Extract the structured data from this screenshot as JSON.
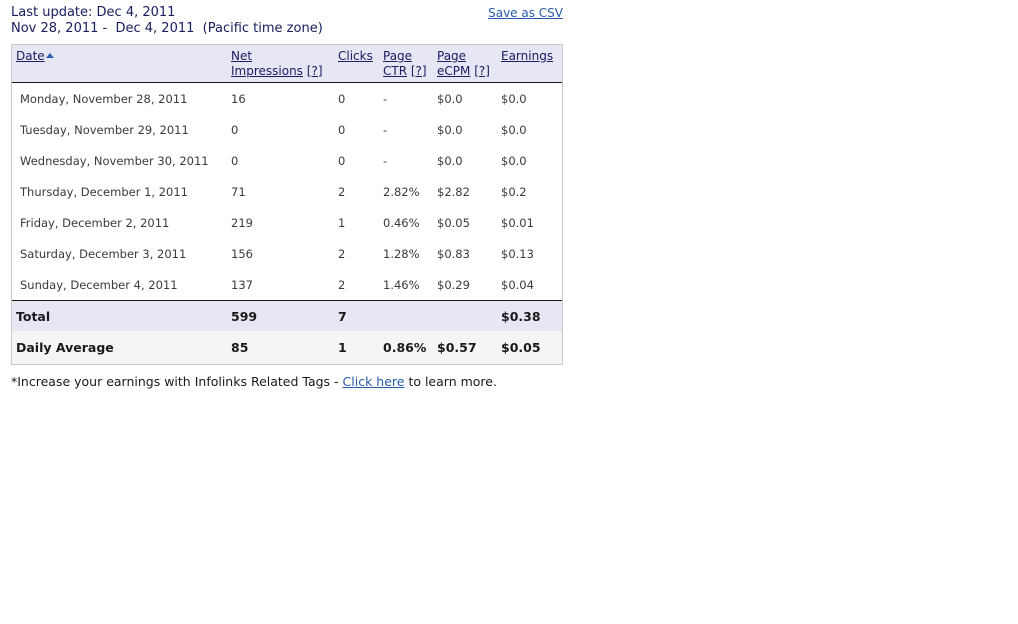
{
  "header": {
    "last_update": "Last update: Dec 4, 2011",
    "date_range": "Nov 28, 2011 -  Dec 4, 2011  (Pacific time zone)",
    "save_csv": "Save as CSV"
  },
  "table": {
    "columns": {
      "date": "Date",
      "net": "Net",
      "impressions": "Impressions",
      "clicks": "Clicks",
      "page1": "Page",
      "ctr": "CTR",
      "page2": "Page",
      "ecpm": "eCPM",
      "earnings": "Earnings",
      "help": "[?]"
    },
    "rows": [
      {
        "date": "Monday, November 28, 2011",
        "impressions": "16",
        "clicks": "0",
        "ctr": "-",
        "ecpm": "$0.0",
        "earnings": "$0.0"
      },
      {
        "date": "Tuesday, November 29, 2011",
        "impressions": "0",
        "clicks": "0",
        "ctr": "-",
        "ecpm": "$0.0",
        "earnings": "$0.0"
      },
      {
        "date": "Wednesday, November 30, 2011",
        "impressions": "0",
        "clicks": "0",
        "ctr": "-",
        "ecpm": "$0.0",
        "earnings": "$0.0"
      },
      {
        "date": "Thursday, December 1, 2011",
        "impressions": "71",
        "clicks": "2",
        "ctr": "2.82%",
        "ecpm": "$2.82",
        "earnings": "$0.2"
      },
      {
        "date": "Friday, December 2, 2011",
        "impressions": "219",
        "clicks": "1",
        "ctr": "0.46%",
        "ecpm": "$0.05",
        "earnings": "$0.01"
      },
      {
        "date": "Saturday, December 3, 2011",
        "impressions": "156",
        "clicks": "2",
        "ctr": "1.28%",
        "ecpm": "$0.83",
        "earnings": "$0.13"
      },
      {
        "date": "Sunday, December 4, 2011",
        "impressions": "137",
        "clicks": "2",
        "ctr": "1.46%",
        "ecpm": "$0.29",
        "earnings": "$0.04"
      }
    ],
    "total": {
      "label": "Total",
      "impressions": "599",
      "clicks": "7",
      "ctr": "",
      "ecpm": "",
      "earnings": "$0.38"
    },
    "average": {
      "label": "Daily Average",
      "impressions": "85",
      "clicks": "1",
      "ctr": "0.86%",
      "ecpm": "$0.57",
      "earnings": "$0.05"
    }
  },
  "footnote": {
    "prefix": "*Increase your earnings with Infolinks Related Tags - ",
    "link": "Click here",
    "suffix": " to learn more."
  },
  "colors": {
    "header_text": "#1a2060",
    "link": "#2a5caa",
    "header_bg": "#e6e6f5",
    "average_bg": "#f5f5f5"
  }
}
